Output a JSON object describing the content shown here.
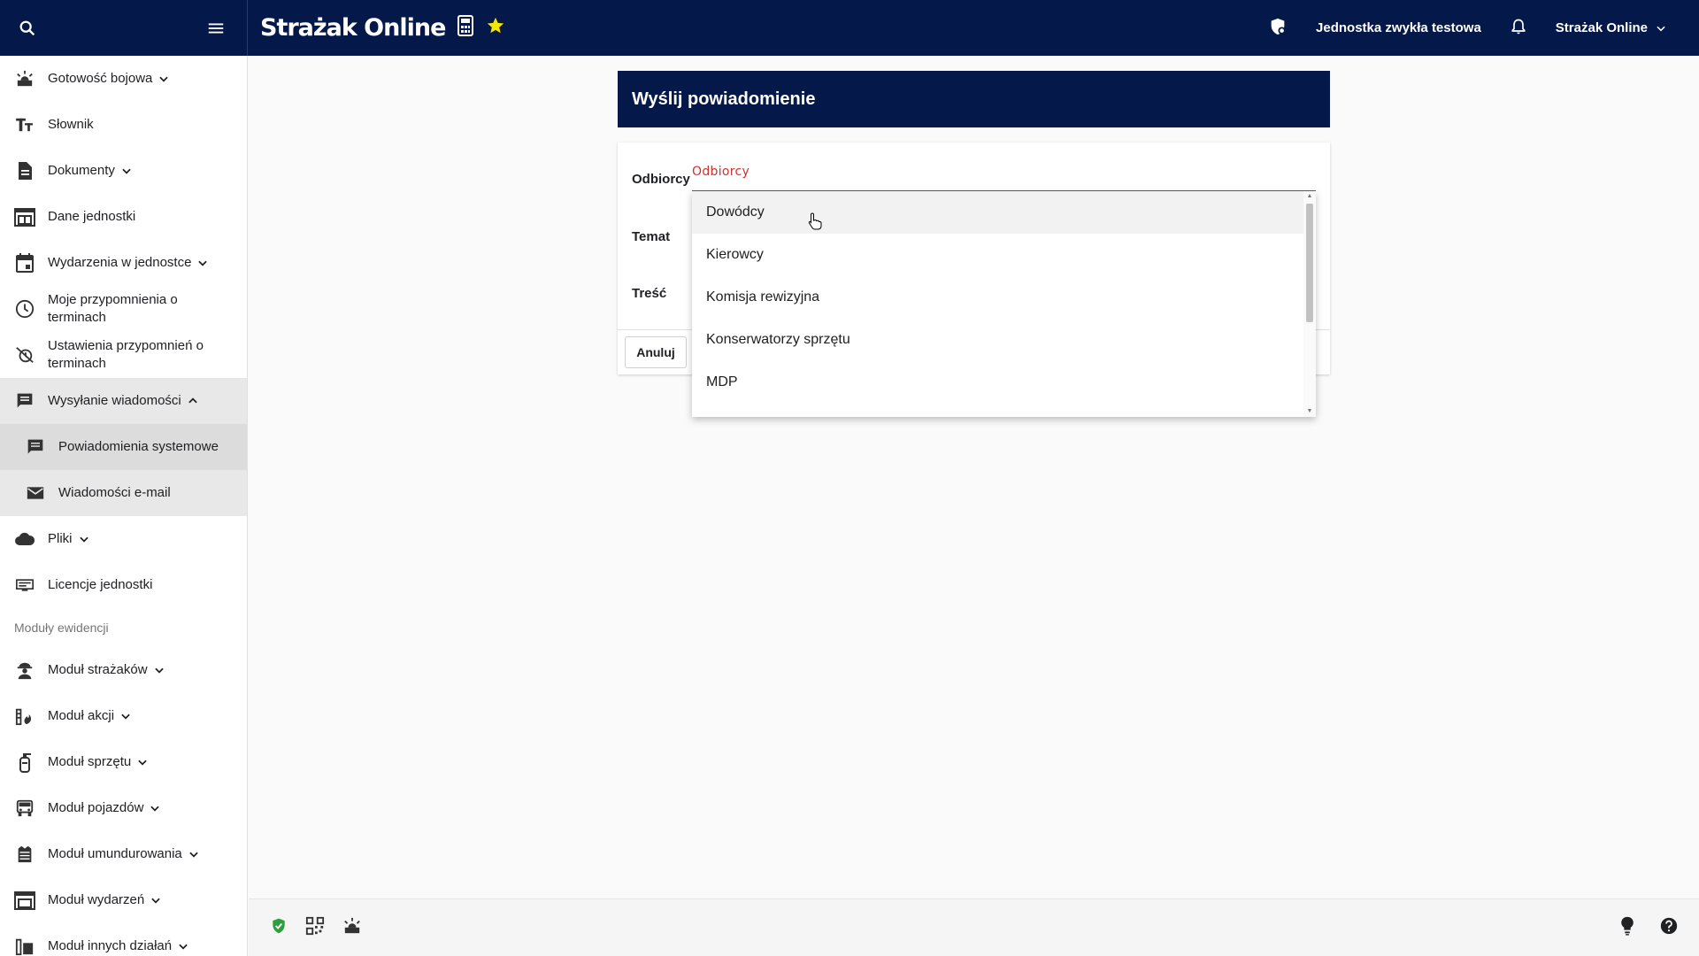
{
  "topbar": {
    "brand": "Strażak Online",
    "unit_name": "Jednostka zwykła testowa",
    "user_menu": "Strażak Online",
    "accent_star_color": "#f5e600"
  },
  "sidebar": {
    "items": [
      {
        "label": "Gotowość bojowa",
        "icon": "alarm-icon",
        "chevron": "down"
      },
      {
        "label": "Słownik",
        "icon": "text-size-icon"
      },
      {
        "label": "Dokumenty",
        "icon": "document-icon",
        "chevron": "down"
      },
      {
        "label": "Dane jednostki",
        "icon": "fire-station-icon"
      },
      {
        "label": "Wydarzenia w jednostce",
        "icon": "calendar-icon",
        "chevron": "down"
      },
      {
        "label": "Moje przypomnienia o terminach",
        "icon": "clock-icon"
      },
      {
        "label": "Ustawienia przypomnień o terminach",
        "icon": "alarm-off-icon"
      },
      {
        "label": "Wysyłanie wiadomości",
        "icon": "message-icon",
        "chevron": "up"
      },
      {
        "label": "Powiadomienia systemowe",
        "icon": "message-icon"
      },
      {
        "label": "Wiadomości e-mail",
        "icon": "mail-icon"
      },
      {
        "label": "Pliki",
        "icon": "cloud-icon",
        "chevron": "down"
      },
      {
        "label": "Licencje jednostki",
        "icon": "license-icon"
      }
    ],
    "section_title": "Moduły ewidencji",
    "modules": [
      {
        "label": "Moduł strażaków",
        "icon": "firefighter-icon"
      },
      {
        "label": "Moduł akcji",
        "icon": "fire-action-icon"
      },
      {
        "label": "Moduł sprzętu",
        "icon": "extinguisher-icon"
      },
      {
        "label": "Moduł pojazdów",
        "icon": "truck-icon"
      },
      {
        "label": "Moduł umundurowania",
        "icon": "uniform-icon"
      },
      {
        "label": "Moduł wydarzeń",
        "icon": "event-icon"
      },
      {
        "label": "Moduł innych działań",
        "icon": "other-icon"
      }
    ]
  },
  "dialog": {
    "title": "Wyślij powiadomienie",
    "fields": {
      "recipients_label": "Odbiorcy",
      "recipients_placeholder": "Odbiorcy",
      "subject_label": "Temat",
      "content_label": "Treść"
    },
    "cancel_label": "Anuluj"
  },
  "dropdown": {
    "options": [
      "Dowódcy",
      "Kierowcy",
      "Komisja rewizyjna",
      "Konserwatorzy sprzętu",
      "MDP"
    ],
    "hovered": "Dowódcy"
  }
}
